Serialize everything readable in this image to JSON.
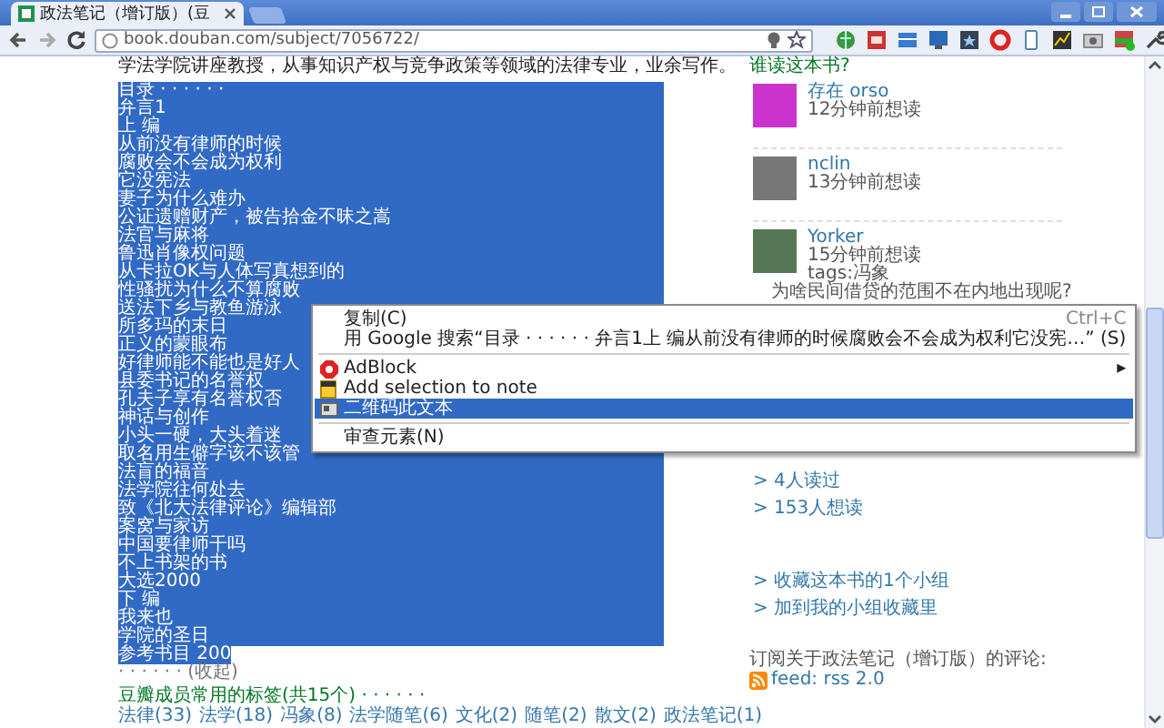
{
  "browser": {
    "tab": {
      "title": "政法笔记（增订版）(豆",
      "selected": true
    },
    "url": "book.douban.com/subject/7056722/"
  },
  "page": {
    "intro": "学法学院讲座教授，从事知识产权与竞争政策等领域的法律专业，业余写作。",
    "toc": {
      "heading": "目录 · · · · · ·",
      "items": [
        "弁言1",
        "上 编",
        "从前没有律师的时候",
        "腐败会不会成为权利",
        "它没宪法",
        "妻子为什么难办",
        "公证遗赠财产，被告拾金不昧之嵩",
        "法官与麻将",
        "鲁迅肖像权问题",
        "从卡拉OK与人体写真想到的",
        "性骚扰为什么不算腐败",
        "送法下乡与教鱼游泳",
        "所多玛的末日",
        "正义的蒙眼布",
        "好律师能不能也是好人",
        "县委书记的名誉权",
        "孔夫子享有名誉权否",
        "神话与创作",
        "小头一硬，大头着迷",
        "取名用生僻字该不该管",
        "法盲的福音",
        "法学院往何处去",
        "致《北大法律评论》编辑部",
        "案窝与家访",
        "中国要律师干吗",
        "不上书架的书",
        "大选2000",
        "下 编",
        "我来也",
        "学院的圣日"
      ],
      "last": "参考书目 200",
      "collapse": "· · · · · · (收起)"
    },
    "tags": {
      "heading": "豆瓣成员常用的标签(共15个) · · · · · ·",
      "items": [
        "法律(33)",
        "法学(18)",
        "冯象(8)",
        "法学随笔(6)",
        "文化(2)",
        "随笔(2)",
        "散文(2)",
        "政法笔记(1)"
      ]
    }
  },
  "sidebar": {
    "heading": "谁读这本书?",
    "readers": [
      {
        "name": "存在 orso",
        "time": "12分钟前想读"
      },
      {
        "name": "nclin",
        "time": "13分钟前想读"
      },
      {
        "name": "Yorker",
        "time": "15分钟前想读",
        "tags": "tags:冯象",
        "comment": "为啥民间借贷的范围不在内地出现呢?"
      }
    ],
    "links": [
      [
        "> 4人读过",
        "> 153人想读"
      ],
      [
        "> 收藏这本书的1个小组",
        "> 加到我的小组收藏里"
      ]
    ],
    "subscribe": "订阅关于政法笔记（增订版）的评论:",
    "feed": "feed: rss 2.0"
  },
  "context_menu": {
    "groups": [
      [
        {
          "kind": "text",
          "label": "复制(C)",
          "shortcut": "Ctrl+C",
          "selected": false
        },
        {
          "kind": "text",
          "label": "用 Google 搜索“目录 · · · · · · 弁言1上 编从前没有律师的时候腐败会不会成为权利它没宪…” (S)",
          "selected": false
        }
      ],
      [
        {
          "kind": "stop",
          "label": "AdBlock",
          "arrow": "▸",
          "selected": false
        },
        {
          "kind": "note",
          "label": "Add selection to note",
          "selected": false
        },
        {
          "kind": "card",
          "label": "二维码此文本",
          "selected": true
        }
      ],
      [
        {
          "kind": "text",
          "label": "审查元素(N)",
          "selected": false
        }
      ]
    ]
  }
}
